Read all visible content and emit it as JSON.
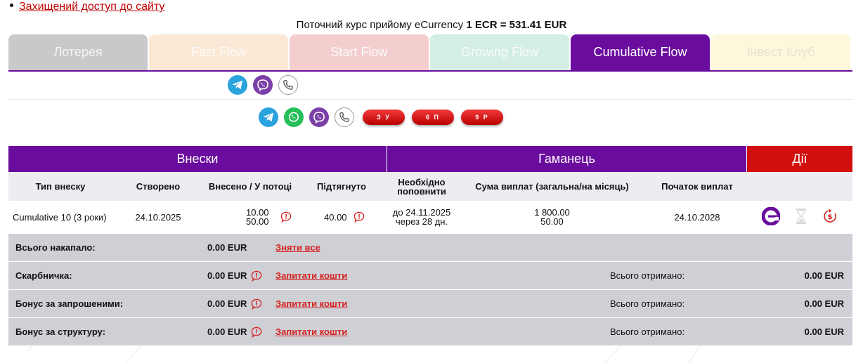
{
  "header": {
    "secure_link": "Захищений доступ до сайту",
    "rate_prefix": "Поточний курс прийому eCurrency ",
    "rate_value": "1 ECR = 531.41 EUR"
  },
  "tabs": [
    {
      "label": "Лотерея",
      "bg": "#c9c9cb",
      "fg": "#f4f4f4"
    },
    {
      "label": "Fast Flow",
      "bg": "#fbe9d6",
      "fg": "#fbfbfb"
    },
    {
      "label": "Start Flow",
      "bg": "#f4cece",
      "fg": "#fbfbfb"
    },
    {
      "label": "Growing Flow",
      "bg": "#d3eee7",
      "fg": "#fbfbfb"
    },
    {
      "label": "Cumulative Flow",
      "bg": "#6a0c9e",
      "fg": "#ffffff"
    },
    {
      "label": "Інвест Клуб",
      "bg": "#fdf8dc",
      "fg": "#e6e4cf"
    }
  ],
  "contacts_row1": [
    "telegram-icon",
    "viber-icon",
    "phone-icon"
  ],
  "contacts_row2": [
    "telegram-icon",
    "whatsapp-icon",
    "viber-icon",
    "phone-icon"
  ],
  "pills": [
    "З У",
    "6 П",
    "9 Р"
  ],
  "table": {
    "group_deposits": "Внески",
    "group_wallet": "Гаманець",
    "group_actions": "Дії",
    "columns": {
      "type": "Тип внеску",
      "created": "Створено",
      "deposited_line": "Внесено / У потоці",
      "pulled": "Підтягнуто",
      "need_top_up": "Необхідно поповнити",
      "payout_sum": "Сума виплат (загальна/на місяць)",
      "payout_start": "Початок виплат"
    },
    "row": {
      "type": "Cumulative 10 (3 роки)",
      "created": "24.10.2025",
      "deposited": "10.00",
      "in_flow": "50.00",
      "pulled": "40.00",
      "top_up_until": "до 24.11.2025",
      "top_up_in": "через 28 дн.",
      "payout_total": "1 800.00",
      "payout_month": "50.00",
      "payout_start": "24.10.2028"
    },
    "summary": [
      {
        "label": "Всього накапало:",
        "value": "0.00 EUR",
        "action": "Зняти все",
        "info": false,
        "total_label": "",
        "total_value": ""
      },
      {
        "label": "Скарбничка:",
        "value": "0.00 EUR",
        "action": "Запитати кошти",
        "info": true,
        "total_label": "Всього отримано:",
        "total_value": "0.00 EUR"
      },
      {
        "label": "Бонус за запрошеними:",
        "value": "0.00 EUR",
        "action": "Запитати кошти",
        "info": true,
        "total_label": "Всього отримано:",
        "total_value": "0.00 EUR"
      },
      {
        "label": "Бонус за структуру:",
        "value": "0.00 EUR",
        "action": "Запитати кошти",
        "info": true,
        "total_label": "Всього отримано:",
        "total_value": "0.00 EUR"
      }
    ]
  },
  "colors": {
    "purple": "#6a0c9e",
    "red_action": "#d10f0f",
    "link_red": "#c00000",
    "info_red": "#d42222",
    "summary_bg": "#cfd0d5",
    "colhdr_bg": "#ececf1"
  }
}
